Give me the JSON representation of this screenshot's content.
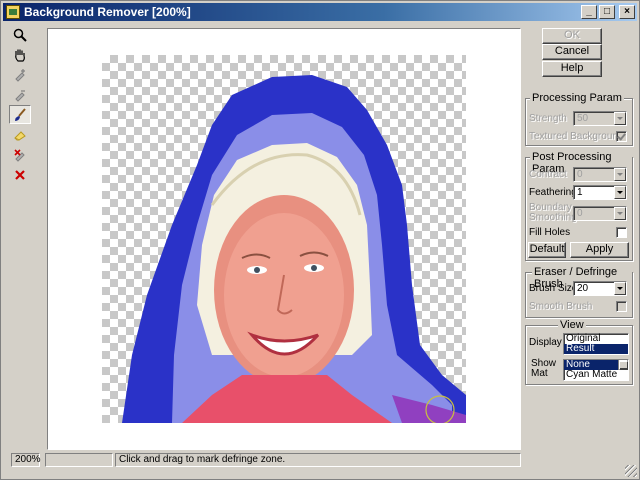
{
  "window": {
    "title": "Background Remover [200%]",
    "controls": {
      "minimize": "_",
      "maximize": "□",
      "close": "×"
    }
  },
  "toolbar": {
    "tools": [
      {
        "name": "zoom-tool",
        "icon": "magnifier-icon",
        "active": false
      },
      {
        "name": "hand-tool",
        "icon": "hand-icon",
        "active": false
      },
      {
        "name": "keep-marker-tool",
        "icon": "marker-plus-icon",
        "active": false
      },
      {
        "name": "remove-marker-tool",
        "icon": "marker-minus-icon",
        "active": false
      },
      {
        "name": "defringe-brush-tool",
        "icon": "brush-icon",
        "active": true
      },
      {
        "name": "eraser-tool",
        "icon": "eraser-icon",
        "active": false
      },
      {
        "name": "clear-marker-tool",
        "icon": "marker-x-icon",
        "active": false
      },
      {
        "name": "clear-all-tool",
        "icon": "red-x-icon",
        "active": false
      }
    ]
  },
  "buttons": {
    "ok": "OK",
    "cancel": "Cancel",
    "help": "Help"
  },
  "processing": {
    "title": "Processing Param",
    "strength_label": "Strength",
    "strength_value": "50",
    "textured_label": "Textured Background",
    "textured_checked": true
  },
  "post_processing": {
    "title": "Post Processing Param",
    "contract_label": "Contract",
    "contract_value": "0",
    "feathering_label": "Feathering",
    "feathering_value": "1",
    "boundary_label_1": "Boundary",
    "boundary_label_2": "Smoothing",
    "boundary_value": "0",
    "fill_holes_label": "Fill Holes",
    "fill_holes_checked": false,
    "default_button": "Default",
    "apply_button": "Apply"
  },
  "brush": {
    "title": "Eraser / Defringe  Brush",
    "size_label": "Brush Size",
    "size_value": "20",
    "smooth_label": "Smooth Brush",
    "smooth_checked": false
  },
  "view": {
    "title": "View",
    "display_label": "Display",
    "display_options": [
      "Original",
      "Result"
    ],
    "display_selected": "Result",
    "show_mat_label_1": "Show",
    "show_mat_label_2": "Mat",
    "mat_options": [
      "None",
      "Cyan Matte"
    ],
    "mat_selected": "None"
  },
  "status": {
    "zoom": "200%",
    "progress": "",
    "message": "Click and drag to mark defringe zone."
  },
  "colors": {
    "title_bar": "#0a246a",
    "selection": "#0a246a",
    "defringe_mask": "#2a32c8",
    "clear_x": "#cc0000"
  }
}
